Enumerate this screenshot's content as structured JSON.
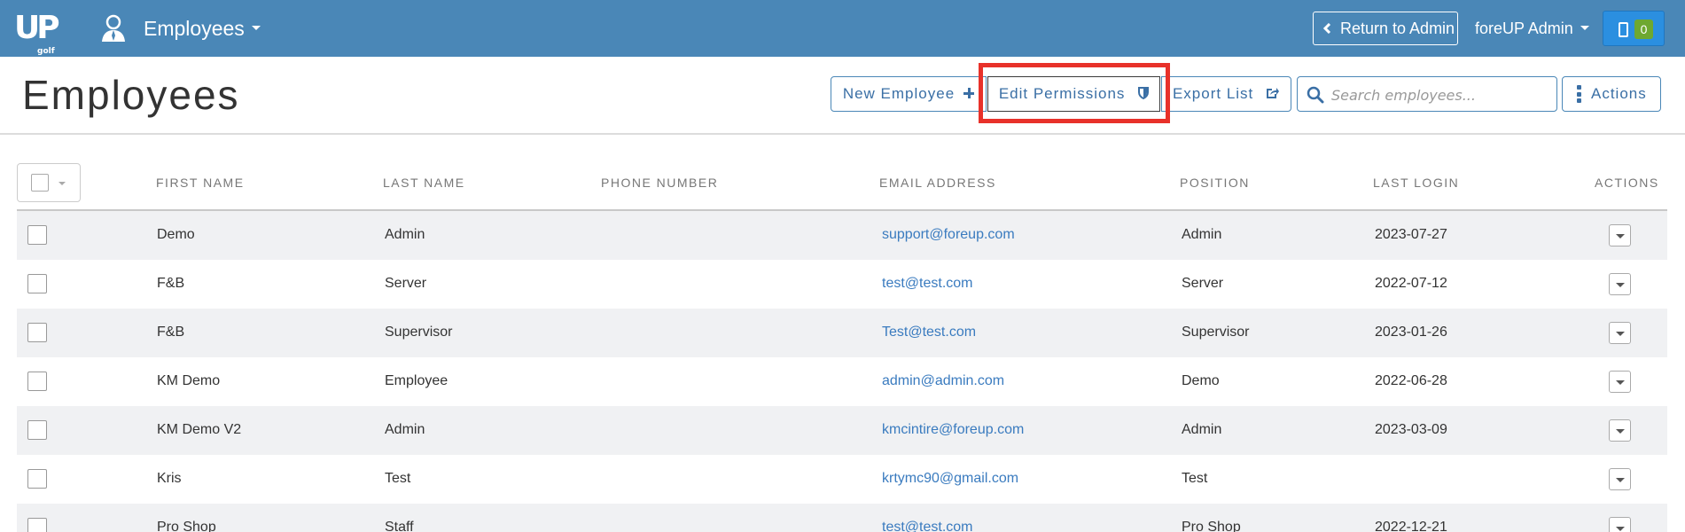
{
  "topbar": {
    "logo": "UP",
    "logo_sub": "golf",
    "module_title": "Employees",
    "return_label": "Return to Admin",
    "user_menu": "foreUP Admin",
    "notification_count": "0"
  },
  "header": {
    "title": "Employees",
    "new_employee": "New Employee",
    "edit_permissions": "Edit Permissions",
    "export_list": "Export List",
    "search_placeholder": "Search employees...",
    "actions": "Actions"
  },
  "colors": {
    "topbar": "#4a87b7",
    "accent": "#3a6fa5",
    "link": "#3a7bbf",
    "highlight": "#e8312a",
    "badge": "#6ea830"
  },
  "table": {
    "columns": [
      "First Name",
      "Last Name",
      "Phone Number",
      "Email Address",
      "Position",
      "Last Login",
      "Actions"
    ],
    "rows": [
      {
        "first": "Demo",
        "last": "Admin",
        "phone": "",
        "email": "support@foreup.com",
        "position": "Admin",
        "login": "2023-07-27"
      },
      {
        "first": "F&B",
        "last": "Server",
        "phone": "",
        "email": "test@test.com",
        "position": "Server",
        "login": "2022-07-12"
      },
      {
        "first": "F&B",
        "last": "Supervisor",
        "phone": "",
        "email": "Test@test.com",
        "position": "Supervisor",
        "login": "2023-01-26"
      },
      {
        "first": "KM Demo",
        "last": "Employee",
        "phone": "",
        "email": "admin@admin.com",
        "position": "Demo",
        "login": "2022-06-28"
      },
      {
        "first": "KM Demo V2",
        "last": "Admin",
        "phone": "",
        "email": "kmcintire@foreup.com",
        "position": "Admin",
        "login": "2023-03-09"
      },
      {
        "first": "Kris",
        "last": "Test",
        "phone": "",
        "email": "krtymc90@gmail.com",
        "position": "Test",
        "login": ""
      },
      {
        "first": "Pro Shop",
        "last": "Staff",
        "phone": "",
        "email": "test@test.com",
        "position": "Pro Shop",
        "login": "2022-12-21"
      }
    ]
  }
}
